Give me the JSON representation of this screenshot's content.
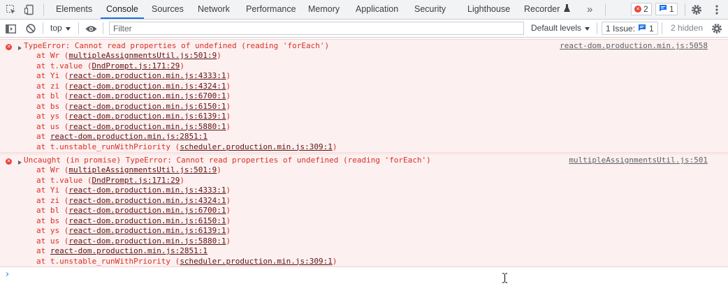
{
  "tabs": [
    {
      "label": "Elements"
    },
    {
      "label": "Console",
      "active": true
    },
    {
      "label": "Sources"
    },
    {
      "label": "Network"
    },
    {
      "label": "Performance"
    },
    {
      "label": "Memory"
    },
    {
      "label": "Application"
    },
    {
      "label": "Security"
    },
    {
      "label": "Lighthouse"
    },
    {
      "label": "Recorder"
    }
  ],
  "tabbar": {
    "more": "»",
    "error_count": "2",
    "message_count": "1"
  },
  "toolbar": {
    "context": "top",
    "filter_placeholder": "Filter",
    "levels": "Default levels",
    "issues_label": "1 Issue:",
    "issues_count": "1",
    "hidden": "2 hidden"
  },
  "colors": {
    "error_text": "#d93025",
    "error_bg": "#fcf0f0",
    "accent": "#1a73e8"
  },
  "messages": [
    {
      "text": "TypeError: Cannot read properties of undefined (reading 'forEach')",
      "source": "react-dom.production.min.js:5058",
      "stack": [
        {
          "prefix": "at Wr (",
          "link": "multipleAssignmentsUtil.js:501:9",
          "suffix": ")"
        },
        {
          "prefix": "at t.value (",
          "link": "DndPrompt.js:171:29",
          "suffix": ")"
        },
        {
          "prefix": "at Yi (",
          "link": "react-dom.production.min.js:4333:1",
          "suffix": ")"
        },
        {
          "prefix": "at zi (",
          "link": "react-dom.production.min.js:4324:1",
          "suffix": ")"
        },
        {
          "prefix": "at bl (",
          "link": "react-dom.production.min.js:6700:1",
          "suffix": ")"
        },
        {
          "prefix": "at bs (",
          "link": "react-dom.production.min.js:6150:1",
          "suffix": ")"
        },
        {
          "prefix": "at ys (",
          "link": "react-dom.production.min.js:6139:1",
          "suffix": ")"
        },
        {
          "prefix": "at us (",
          "link": "react-dom.production.min.js:5880:1",
          "suffix": ")"
        },
        {
          "prefix": "at ",
          "link": "react-dom.production.min.js:2851:1",
          "suffix": ""
        },
        {
          "prefix": "at t.unstable_runWithPriority (",
          "link": "scheduler.production.min.js:309:1",
          "suffix": ")"
        }
      ]
    },
    {
      "text": "Uncaught (in promise) TypeError: Cannot read properties of undefined (reading 'forEach')",
      "source": "multipleAssignmentsUtil.js:501",
      "stack": [
        {
          "prefix": "at Wr (",
          "link": "multipleAssignmentsUtil.js:501:9",
          "suffix": ")"
        },
        {
          "prefix": "at t.value (",
          "link": "DndPrompt.js:171:29",
          "suffix": ")"
        },
        {
          "prefix": "at Yi (",
          "link": "react-dom.production.min.js:4333:1",
          "suffix": ")"
        },
        {
          "prefix": "at zi (",
          "link": "react-dom.production.min.js:4324:1",
          "suffix": ")"
        },
        {
          "prefix": "at bl (",
          "link": "react-dom.production.min.js:6700:1",
          "suffix": ")"
        },
        {
          "prefix": "at bs (",
          "link": "react-dom.production.min.js:6150:1",
          "suffix": ")"
        },
        {
          "prefix": "at ys (",
          "link": "react-dom.production.min.js:6139:1",
          "suffix": ")"
        },
        {
          "prefix": "at us (",
          "link": "react-dom.production.min.js:5880:1",
          "suffix": ")"
        },
        {
          "prefix": "at ",
          "link": "react-dom.production.min.js:2851:1",
          "suffix": ""
        },
        {
          "prefix": "at t.unstable_runWithPriority (",
          "link": "scheduler.production.min.js:309:1",
          "suffix": ")"
        }
      ]
    }
  ],
  "prompt": "›"
}
